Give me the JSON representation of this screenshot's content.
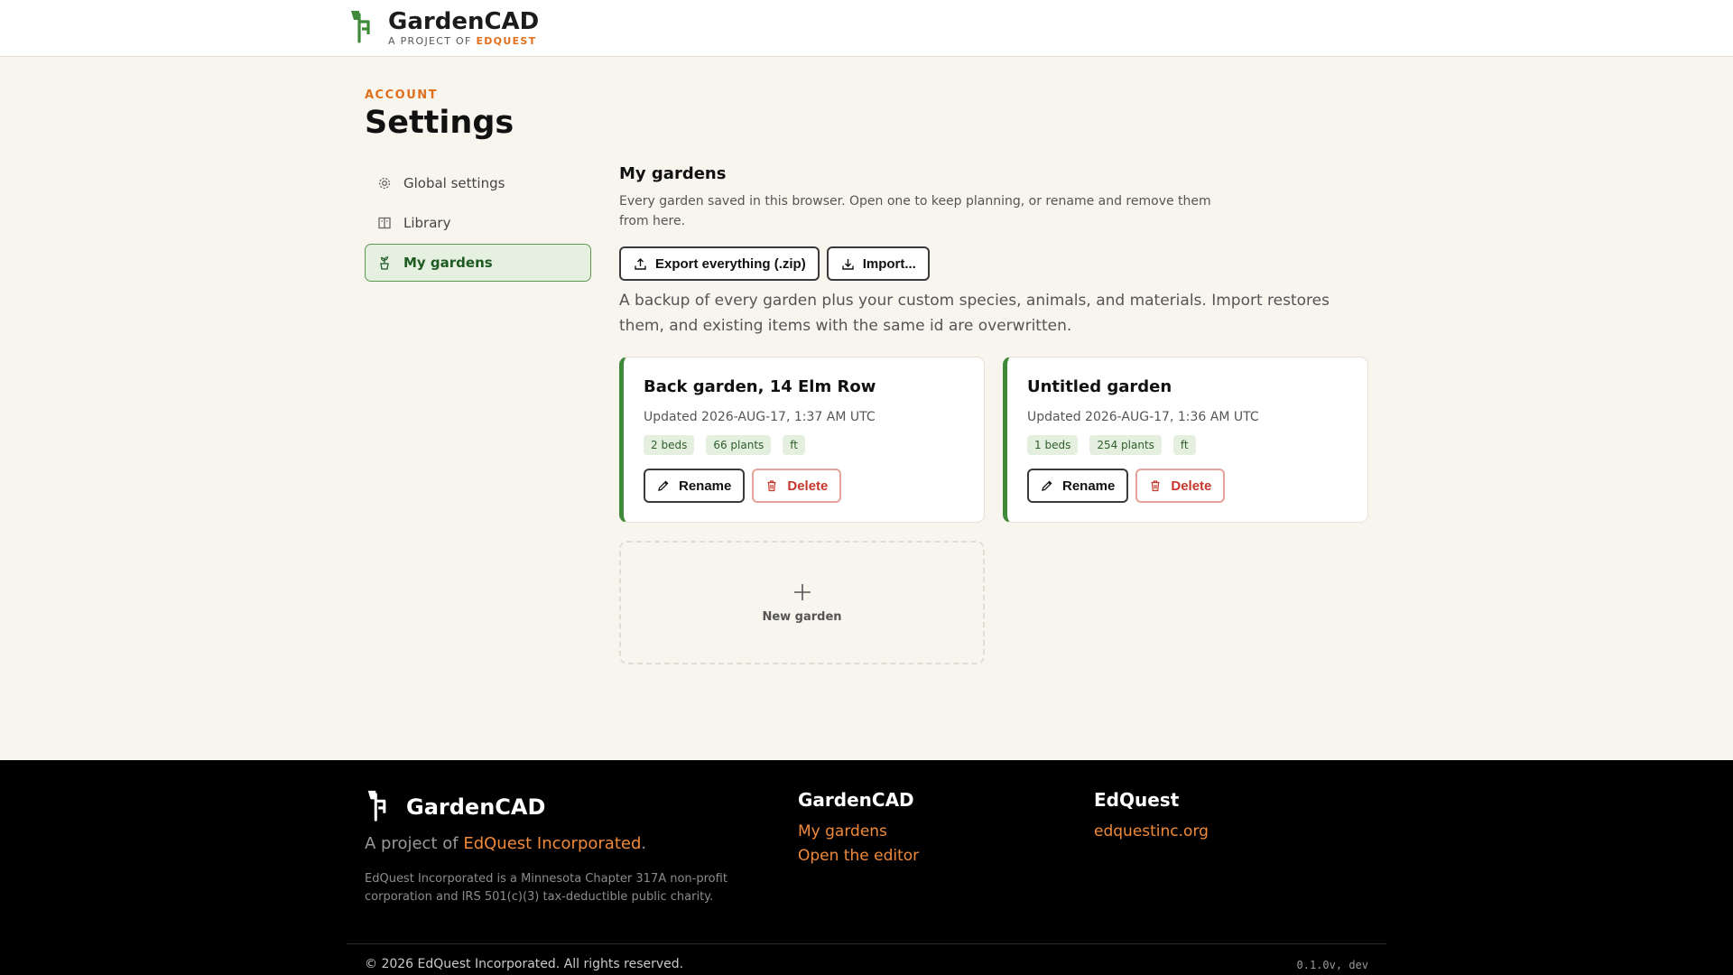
{
  "header": {
    "app_name": "GardenCAD",
    "sub_prefix": "A PROJECT OF",
    "sub_brand": "EDQUEST",
    "logo_icon": "sprout-icon"
  },
  "page": {
    "eyebrow": "ACCOUNT",
    "title": "Settings"
  },
  "sidebar": {
    "items": [
      {
        "label": "Global settings",
        "icon": "gear-icon",
        "active": false
      },
      {
        "label": "Library",
        "icon": "book-icon",
        "active": false
      },
      {
        "label": "My gardens",
        "icon": "plant-pot-icon",
        "active": true
      }
    ]
  },
  "main": {
    "title": "My gardens",
    "description": "Every garden saved in this browser. Open one to keep planning, or rename and remove them from here.",
    "export_label": "Export everything (.zip)",
    "import_label": "Import...",
    "backup_note": "A backup of every garden plus your custom species, animals, and materials. Import restores them, and existing items with the same id are overwritten.",
    "gardens": [
      {
        "name": "Back garden, 14 Elm Row",
        "updated": "Updated 2026-AUG-17, 1:37 AM UTC",
        "tags": [
          "2 beds",
          "66 plants",
          "ft"
        ],
        "rename_label": "Rename",
        "delete_label": "Delete"
      },
      {
        "name": "Untitled garden",
        "updated": "Updated 2026-AUG-17, 1:36 AM UTC",
        "tags": [
          "1 beds",
          "254 plants",
          "ft"
        ],
        "rename_label": "Rename",
        "delete_label": "Delete"
      }
    ],
    "new_garden_label": "New garden"
  },
  "footer": {
    "brand": "GardenCAD",
    "tagline_prefix": "A project of",
    "tagline_link": "EdQuest Incorporated",
    "tagline_suffix": ".",
    "legal": "EdQuest Incorporated is a Minnesota Chapter 317A non-profit corporation and IRS 501(c)(3) tax-deductible public charity.",
    "col1_title": "GardenCAD",
    "col1_links": [
      "My gardens",
      "Open the editor"
    ],
    "col2_title": "EdQuest",
    "col2_links": [
      "edquestinc.org"
    ],
    "copyright": "© 2026 EdQuest Incorporated. All rights reserved.",
    "version": "0.1.0v, dev"
  },
  "colors": {
    "accent_orange": "#e0701e",
    "accent_green": "#3f8a3a",
    "delete_red": "#c8372b",
    "background": "#f8f5ef"
  }
}
